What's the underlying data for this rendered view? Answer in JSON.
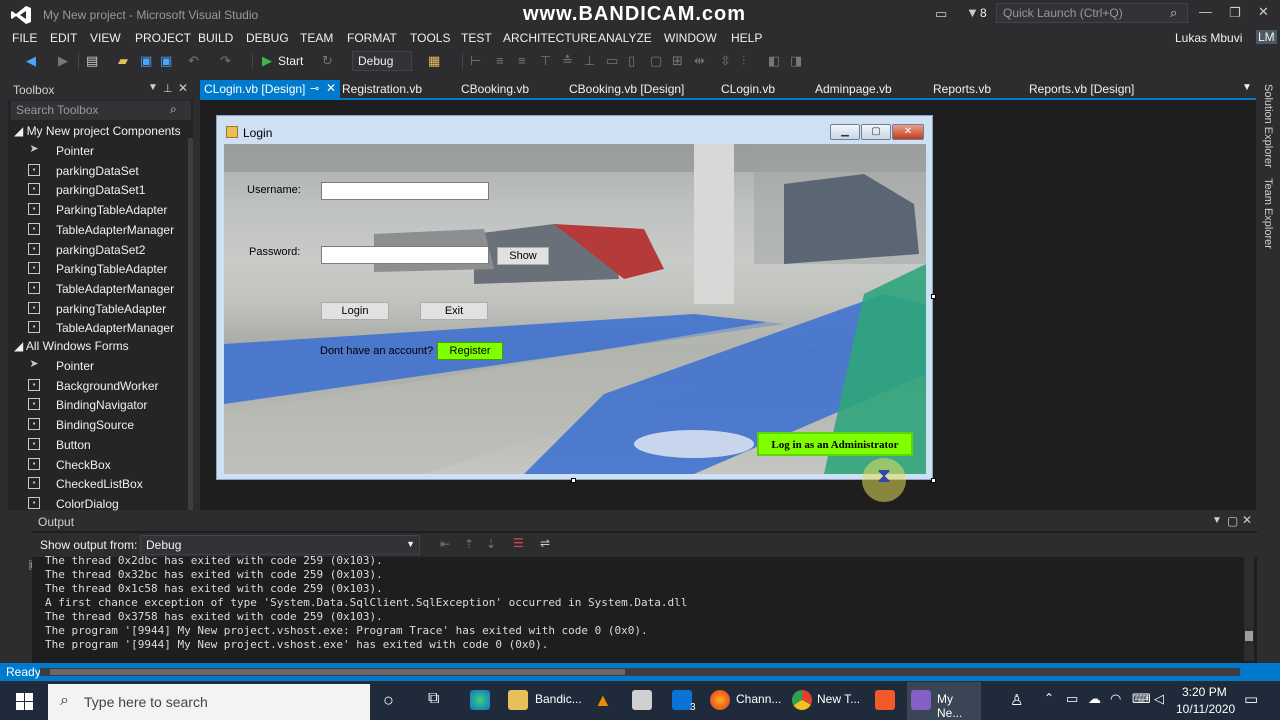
{
  "window": {
    "title": "My New project - Microsoft Visual Studio",
    "watermark": "www.BANDICAM.com",
    "notification_count": "8",
    "quick_launch_placeholder": "Quick Launch (Ctrl+Q)",
    "user_name": "Lukas Mbuvi",
    "user_initials": "LM"
  },
  "menu": [
    "FILE",
    "EDIT",
    "VIEW",
    "PROJECT",
    "BUILD",
    "DEBUG",
    "TEAM",
    "FORMAT",
    "TOOLS",
    "TEST",
    "ARCHITECTURE",
    "ANALYZE",
    "WINDOW",
    "HELP"
  ],
  "toolbar": {
    "start_label": "Start",
    "config": "Debug"
  },
  "toolbox": {
    "title": "Toolbox",
    "search_placeholder": "Search Toolbox",
    "group1": "My New project Components",
    "group1_items": [
      "Pointer",
      "parkingDataSet",
      "parkingDataSet1",
      "ParkingTableAdapter",
      "TableAdapterManager",
      "parkingDataSet2",
      "ParkingTableAdapter",
      "TableAdapterManager",
      "parkingTableAdapter",
      "TableAdapterManager"
    ],
    "group2": "All Windows Forms",
    "group2_items": [
      "Pointer",
      "BackgroundWorker",
      "BindingNavigator",
      "BindingSource",
      "Button",
      "CheckBox",
      "CheckedListBox",
      "ColorDialog"
    ]
  },
  "tabs": [
    "CLogin.vb [Design]",
    "Registration.vb",
    "CBooking.vb",
    "CBooking.vb [Design]",
    "CLogin.vb",
    "Adminpage.vb",
    "Reports.vb",
    "Reports.vb [Design]"
  ],
  "form": {
    "title": "Login",
    "username_label": "Username:",
    "password_label": "Password:",
    "show_button": "Show",
    "login_button": "Login",
    "exit_button": "Exit",
    "no_account_label": "Dont have an account?",
    "register_button": "Register",
    "admin_button": "Log in as an Administrator"
  },
  "output": {
    "title": "Output",
    "show_from_label": "Show output from:",
    "show_from_value": "Debug",
    "lines": [
      "The thread 0x2dbc has exited with code 259 (0x103).",
      "The thread 0x32bc has exited with code 259 (0x103).",
      "The thread 0x1c58 has exited with code 259 (0x103).",
      "A first chance exception of type 'System.Data.SqlClient.SqlException' occurred in System.Data.dll",
      "The thread 0x3758 has exited with code 259 (0x103).",
      "The program '[9944] My New project.vshost.exe: Program Trace' has exited with code 0 (0x0).",
      "The program '[9944] My New project.vshost.exe' has exited with code 0 (0x0)."
    ]
  },
  "side_panels": [
    "Solution Explorer",
    "Team Explorer"
  ],
  "status": {
    "text": "Ready"
  },
  "taskbar": {
    "search_placeholder": "Type here to search",
    "apps": [
      "Bandic...",
      "Chann...",
      "New T...",
      "My Ne..."
    ],
    "mail_badge": "3",
    "time": "3:20 PM",
    "date": "10/11/2020"
  }
}
